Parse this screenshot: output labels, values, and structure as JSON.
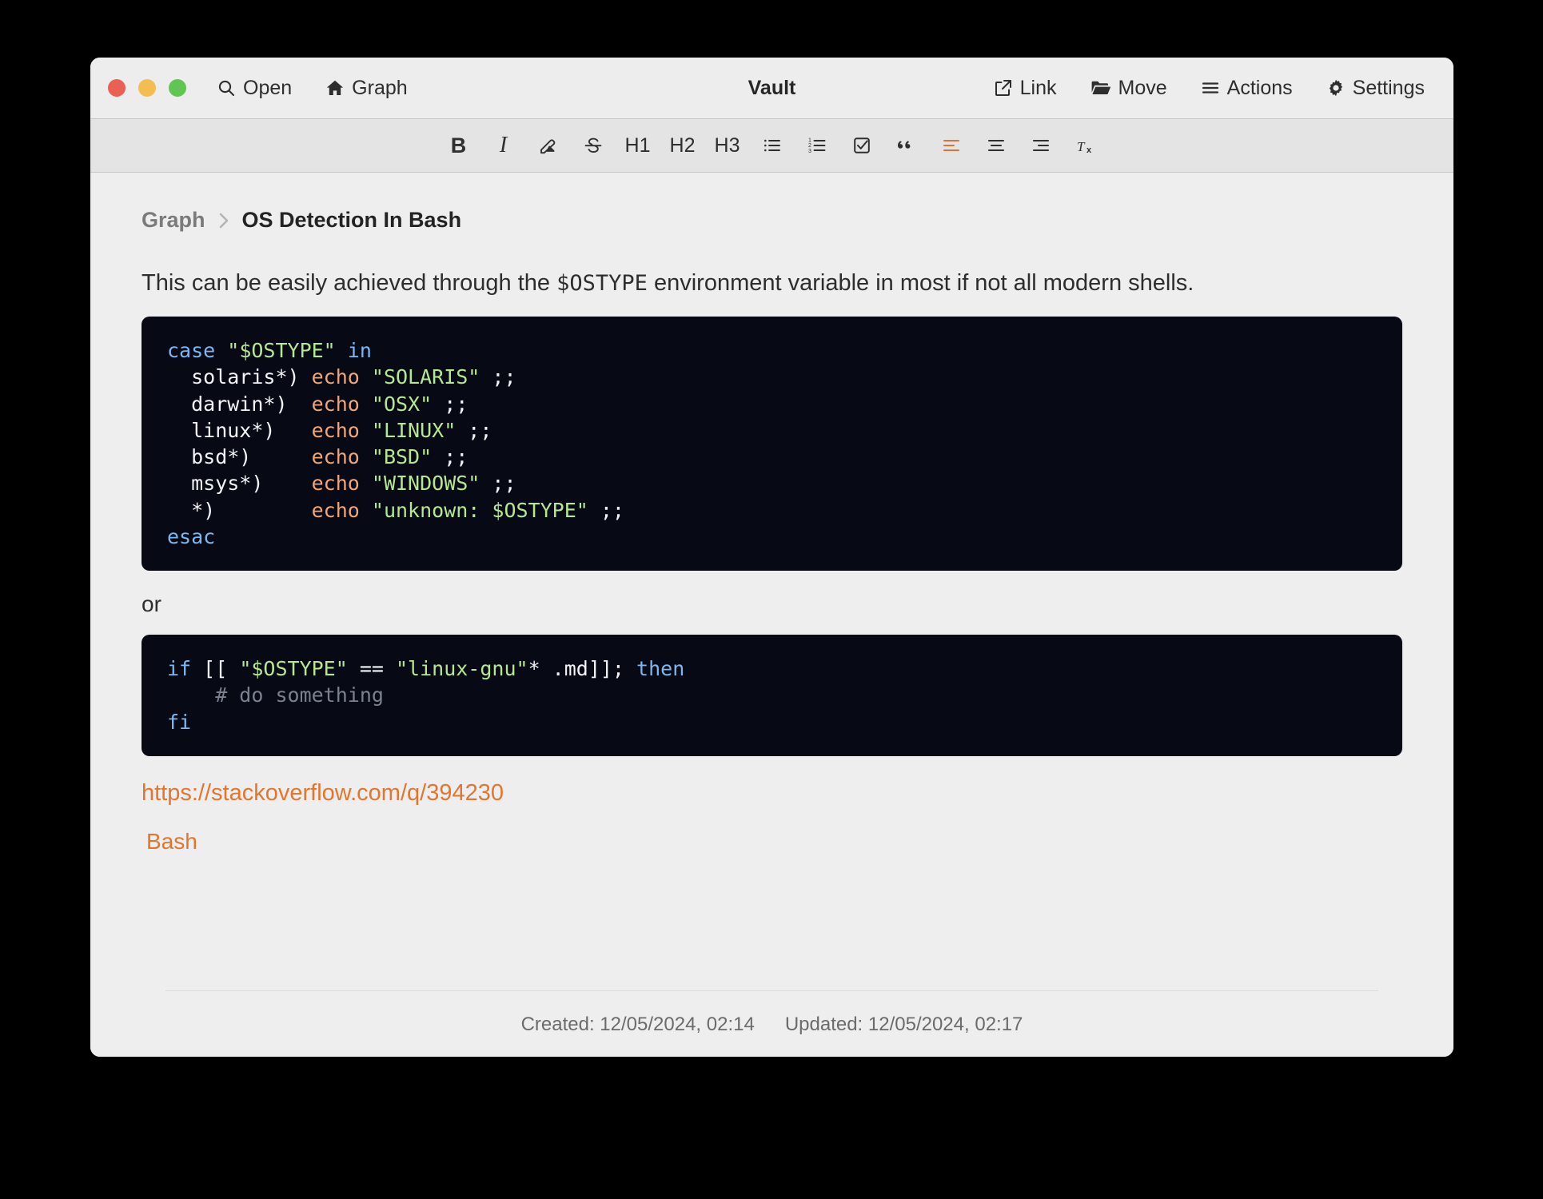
{
  "window": {
    "title": "Vault",
    "traffic_lights": [
      "close",
      "minimize",
      "zoom"
    ]
  },
  "titlebar": {
    "left_buttons": [
      {
        "label": "Open",
        "icon": "search-icon"
      },
      {
        "label": "Graph",
        "icon": "home-icon"
      }
    ],
    "right_buttons": [
      {
        "label": "Link",
        "icon": "external-link-icon"
      },
      {
        "label": "Move",
        "icon": "folder-icon"
      },
      {
        "label": "Actions",
        "icon": "hamburger-icon"
      },
      {
        "label": "Settings",
        "icon": "gear-icon"
      }
    ]
  },
  "formatbar": {
    "items": [
      {
        "name": "bold",
        "label": "B",
        "icon": "bold-icon"
      },
      {
        "name": "italic",
        "label": "I",
        "icon": "italic-icon"
      },
      {
        "name": "highlight",
        "label": "",
        "icon": "highlighter-icon"
      },
      {
        "name": "strikethrough",
        "label": "",
        "icon": "strikethrough-icon"
      },
      {
        "name": "heading-1",
        "label": "H1",
        "icon": "h1-icon"
      },
      {
        "name": "heading-2",
        "label": "H2",
        "icon": "h2-icon"
      },
      {
        "name": "heading-3",
        "label": "H3",
        "icon": "h3-icon"
      },
      {
        "name": "bullet-list",
        "label": "",
        "icon": "bullet-list-icon"
      },
      {
        "name": "numbered-list",
        "label": "",
        "icon": "numbered-list-icon"
      },
      {
        "name": "checklist",
        "label": "",
        "icon": "checkbox-icon"
      },
      {
        "name": "blockquote",
        "label": "",
        "icon": "quote-icon"
      },
      {
        "name": "align-left",
        "label": "",
        "icon": "align-left-icon"
      },
      {
        "name": "align-center",
        "label": "",
        "icon": "align-center-icon"
      },
      {
        "name": "align-right",
        "label": "",
        "icon": "align-right-icon"
      },
      {
        "name": "clear-format",
        "label": "",
        "icon": "clear-format-icon"
      }
    ],
    "active": "align-left",
    "accent_color": "#d9743b"
  },
  "breadcrumb": {
    "root": "Graph",
    "separator": "›",
    "current": "OS Detection In Bash"
  },
  "note": {
    "paragraph_before": "This can be easily achieved through the ",
    "paragraph_code": "$OSTYPE",
    "paragraph_after": " environment variable in most if not all modern shells.",
    "code_block_1": [
      [
        {
          "t": "case ",
          "c": "kw"
        },
        {
          "t": "\"$OSTYPE\"",
          "c": "str"
        },
        {
          "t": " in",
          "c": "kw"
        }
      ],
      [
        {
          "t": "  solaris*) ",
          "c": "plain"
        },
        {
          "t": "echo ",
          "c": "fn"
        },
        {
          "t": "\"SOLARIS\"",
          "c": "str"
        },
        {
          "t": " ;;",
          "c": "plain"
        }
      ],
      [
        {
          "t": "  darwin*)  ",
          "c": "plain"
        },
        {
          "t": "echo ",
          "c": "fn"
        },
        {
          "t": "\"OSX\"",
          "c": "str"
        },
        {
          "t": " ;;",
          "c": "plain"
        }
      ],
      [
        {
          "t": "  linux*)   ",
          "c": "plain"
        },
        {
          "t": "echo ",
          "c": "fn"
        },
        {
          "t": "\"LINUX\"",
          "c": "str"
        },
        {
          "t": " ;;",
          "c": "plain"
        }
      ],
      [
        {
          "t": "  bsd*)     ",
          "c": "plain"
        },
        {
          "t": "echo ",
          "c": "fn"
        },
        {
          "t": "\"BSD\"",
          "c": "str"
        },
        {
          "t": " ;;",
          "c": "plain"
        }
      ],
      [
        {
          "t": "  msys*)    ",
          "c": "plain"
        },
        {
          "t": "echo ",
          "c": "fn"
        },
        {
          "t": "\"WINDOWS\"",
          "c": "str"
        },
        {
          "t": " ;;",
          "c": "plain"
        }
      ],
      [
        {
          "t": "  *)       ",
          "c": "plain"
        },
        {
          "t": " echo ",
          "c": "fn"
        },
        {
          "t": "\"unknown: $OSTYPE\"",
          "c": "str"
        },
        {
          "t": " ;;",
          "c": "plain"
        }
      ],
      [
        {
          "t": "esac",
          "c": "kw"
        }
      ]
    ],
    "or_text": "or",
    "code_block_2": [
      [
        {
          "t": "if ",
          "c": "kw"
        },
        {
          "t": "[[ ",
          "c": "plain"
        },
        {
          "t": "\"$OSTYPE\"",
          "c": "str"
        },
        {
          "t": " == ",
          "c": "plain"
        },
        {
          "t": "\"linux-gnu\"",
          "c": "str"
        },
        {
          "t": "* .md]]; ",
          "c": "plain"
        },
        {
          "t": "then",
          "c": "kw"
        }
      ],
      [
        {
          "t": "    # do something",
          "c": "comment"
        }
      ],
      [
        {
          "t": "fi",
          "c": "kw"
        }
      ]
    ],
    "link": "https://stackoverflow.com/q/394230",
    "tag": "Bash",
    "link_color": "#e2762f"
  },
  "footer": {
    "created": "Created: 12/05/2024, 02:14",
    "updated": "Updated: 12/05/2024, 02:17"
  }
}
